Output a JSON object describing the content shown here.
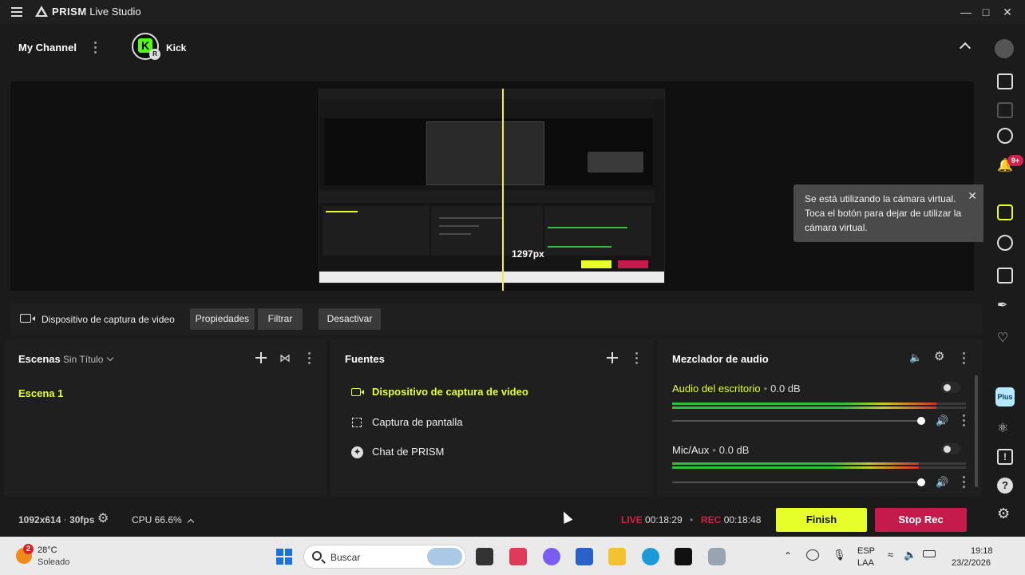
{
  "app": {
    "name": "PRISM",
    "name_suffix": "Live Studio"
  },
  "channel": {
    "label": "My Channel",
    "platform": "Kick",
    "platform_badge": "R"
  },
  "preview": {
    "measure_label": "1297px"
  },
  "source_bar": {
    "source_name": "Dispositivo de captura de video",
    "buttons": [
      "Propiedades",
      "Filtrar",
      "Desactivar"
    ]
  },
  "scenes": {
    "title": "Escenas",
    "scene_collection": "Sin Título",
    "items": [
      "Escena 1"
    ]
  },
  "sources": {
    "title": "Fuentes",
    "items": [
      {
        "label": "Dispositivo de captura de video",
        "icon": "camera-icon",
        "active": true
      },
      {
        "label": "Captura de pantalla",
        "icon": "screen-capture-icon",
        "active": false
      },
      {
        "label": "Chat de PRISM",
        "icon": "chat-icon",
        "active": false
      }
    ]
  },
  "mixer": {
    "title": "Mezclador de audio",
    "channels": [
      {
        "name": "Audio del escritorio",
        "level": "0.0 dB",
        "meter_fill": 0.9,
        "slider_value": 1.0
      },
      {
        "name": "Mic/Aux",
        "level": "0.0 dB",
        "meter_fill": 0.84,
        "slider_value": 1.0
      }
    ]
  },
  "status": {
    "resolution": "1092x614",
    "fps": "30fps",
    "cpu": "CPU 66.6%",
    "live_label": "LIVE",
    "live_time": "00:18:29",
    "rec_label": "REC",
    "rec_time": "00:18:48",
    "finish_label": "Finish",
    "stop_rec_label": "Stop Rec"
  },
  "notification": {
    "text": "Se está utilizando la cámara virtual. Toca el botón para dejar de utilizar la cámara virtual."
  },
  "sidebar": {
    "notification_badge": "9+",
    "plus_label": "Plus"
  },
  "taskbar": {
    "weather_badge": "2",
    "temperature": "28°C",
    "condition": "Soleado",
    "search_placeholder": "Buscar",
    "lang_top": "ESP",
    "lang_bottom": "LAA",
    "time": "19:18",
    "date": "23/2/2026"
  },
  "colors": {
    "accent_yellow": "#e6ff2a",
    "live_red": "#d61f4b",
    "stop_rec": "#c41a4c",
    "kick_green": "#53fc18"
  }
}
